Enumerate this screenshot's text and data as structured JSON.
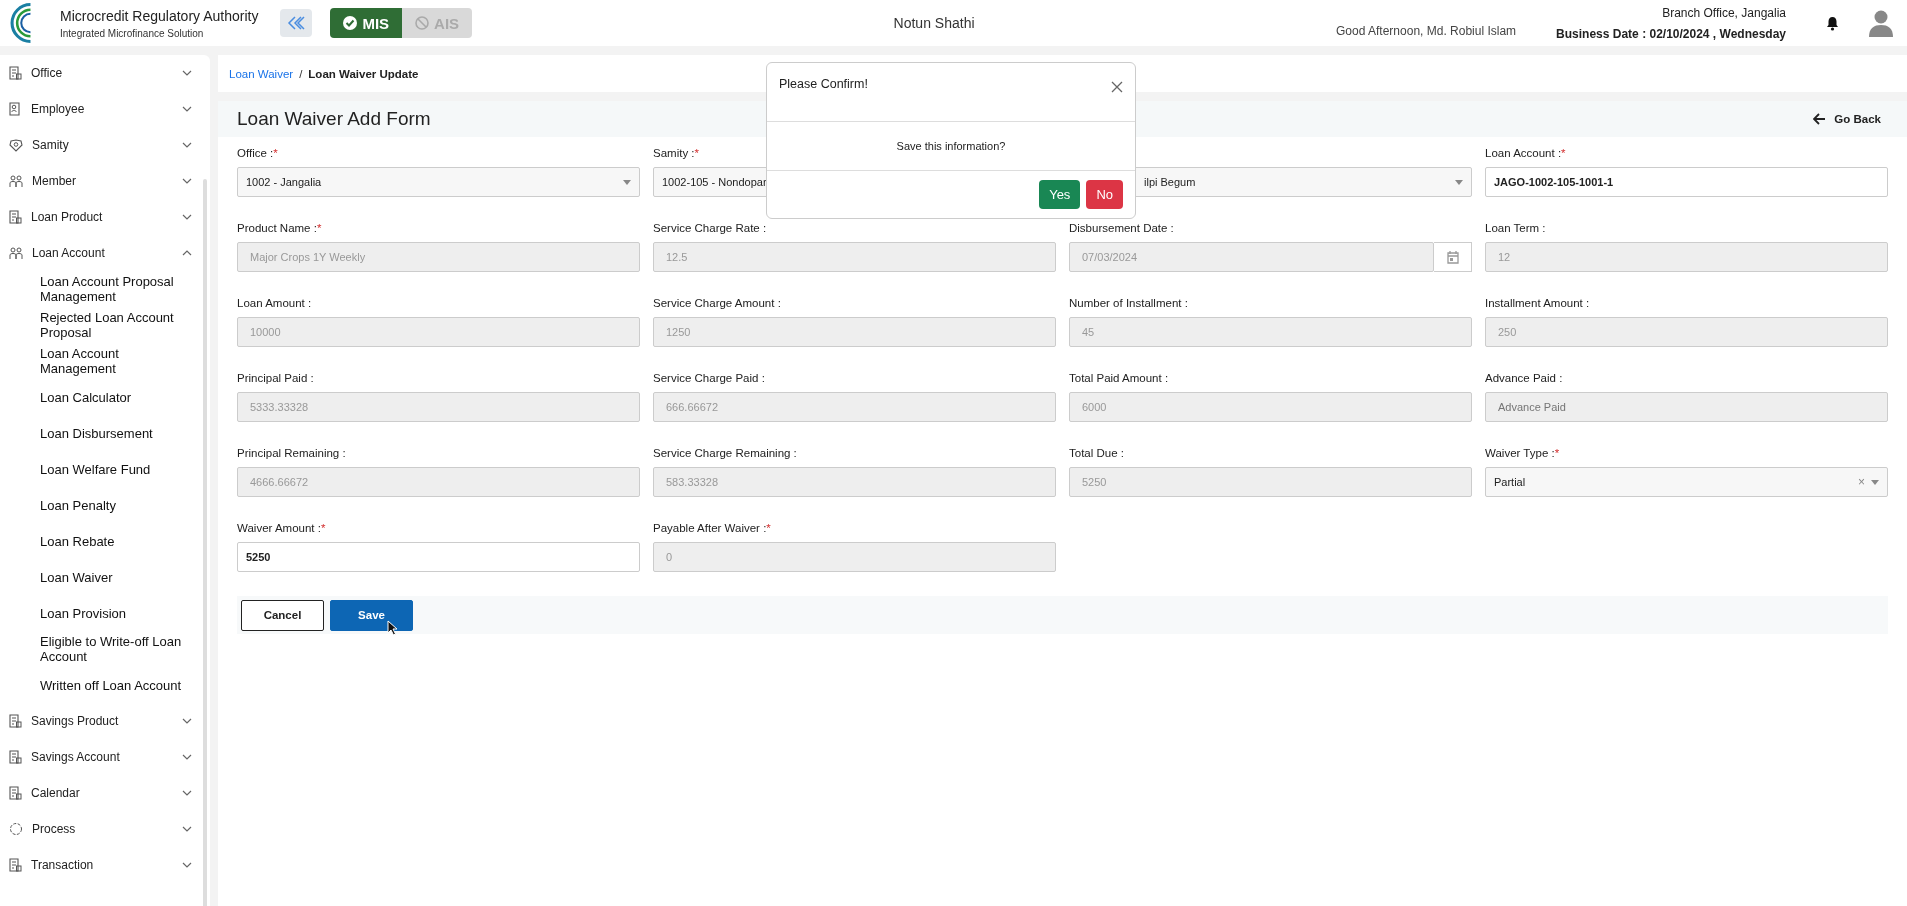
{
  "header": {
    "org_name": "Microcredit Regulatory Authority",
    "org_subtitle": "Integrated Microfinance Solution",
    "modes": [
      {
        "label": "MIS",
        "selected": true
      },
      {
        "label": "AIS",
        "selected": false
      }
    ],
    "app_name": "Notun Shathi",
    "greeting": "Good Afternoon, Md. Robiul Islam",
    "branch": "Branch Office, Jangalia",
    "business_date": "Business Date : 02/10/2024 , Wednesday"
  },
  "sidebar": {
    "items": [
      {
        "label": "Office",
        "kind": "doc",
        "expanded": false
      },
      {
        "label": "Employee",
        "kind": "id",
        "expanded": false
      },
      {
        "label": "Samity",
        "kind": "badge",
        "expanded": false
      },
      {
        "label": "Member",
        "kind": "people",
        "expanded": false
      },
      {
        "label": "Loan Product",
        "kind": "doc",
        "expanded": false
      },
      {
        "label": "Loan Account",
        "kind": "people",
        "expanded": true,
        "children": [
          {
            "label": "Loan Account Proposal Management"
          },
          {
            "label": "Rejected Loan Account Proposal"
          },
          {
            "label": "Loan Account Management"
          },
          {
            "label": "Loan Calculator"
          },
          {
            "label": "Loan Disbursement"
          },
          {
            "label": "Loan Welfare Fund"
          },
          {
            "label": "Loan Penalty"
          },
          {
            "label": "Loan Rebate"
          },
          {
            "label": "Loan Waiver"
          },
          {
            "label": "Loan Provision"
          },
          {
            "label": "Eligible to Write-off Loan Account"
          },
          {
            "label": "Written off Loan Account"
          }
        ]
      },
      {
        "label": "Savings Product",
        "kind": "doc",
        "expanded": false
      },
      {
        "label": "Savings Account",
        "kind": "doc",
        "expanded": false
      },
      {
        "label": "Calendar",
        "kind": "doc",
        "expanded": false
      },
      {
        "label": "Process",
        "kind": "process",
        "expanded": false
      },
      {
        "label": "Transaction",
        "kind": "doc",
        "expanded": false
      }
    ]
  },
  "breadcrumb": [
    {
      "label": "Loan Waiver",
      "kind": "link"
    },
    {
      "label": "/",
      "kind": "separator"
    },
    {
      "label": "Loan Waiver Update",
      "kind": "current"
    }
  ],
  "form": {
    "title": "Loan Waiver Add Form",
    "back": "Go Back",
    "fields": [
      {
        "label": "Office :",
        "required_mark": "*",
        "kind": "select",
        "value": "1002 - Jangalia",
        "disabled": false
      },
      {
        "label": "Samity :",
        "required_mark": "*",
        "kind": "select",
        "value": "1002-105 - Nondopar",
        "disabled": false
      },
      {
        "kind": "select",
        "value": "ilpi Begum",
        "disabled": false
      },
      {
        "label": "Loan Account :",
        "required_mark": "*",
        "kind": "text",
        "value": "JAGO-1002-105-1001-1",
        "disabled": false
      },
      {
        "label": "Product Name :",
        "required_mark": "*",
        "kind": "text",
        "value": "Major Crops 1Y Weekly",
        "disabled": true
      },
      {
        "label": "Service Charge Rate :",
        "kind": "text",
        "value": "12.5",
        "disabled": true
      },
      {
        "label": "Disbursement Date :",
        "kind": "date",
        "value": "07/03/2024",
        "disabled": true
      },
      {
        "label": "Loan Term :",
        "kind": "text",
        "value": "12",
        "disabled": true
      },
      {
        "label": "Loan Amount :",
        "kind": "text",
        "value": "10000",
        "disabled": true
      },
      {
        "label": "Service Charge Amount :",
        "kind": "text",
        "value": "1250",
        "disabled": true
      },
      {
        "label": "Number of Installment :",
        "kind": "text",
        "value": "45",
        "disabled": true
      },
      {
        "label": "Installment Amount :",
        "kind": "text",
        "value": "250",
        "disabled": true
      },
      {
        "label": "Principal Paid :",
        "kind": "text",
        "value": "5333.33328",
        "disabled": true
      },
      {
        "label": "Service Charge Paid :",
        "kind": "text",
        "value": "666.66672",
        "disabled": true
      },
      {
        "label": "Total Paid Amount :",
        "kind": "text",
        "value": "6000",
        "disabled": true
      },
      {
        "label": "Advance Paid :",
        "kind": "text",
        "placeholder": "Advance Paid",
        "disabled": true
      },
      {
        "label": "Principal Remaining :",
        "kind": "text",
        "value": "4666.66672",
        "disabled": true
      },
      {
        "label": "Service Charge Remaining :",
        "kind": "text",
        "value": "583.33328",
        "disabled": true
      },
      {
        "label": "Total Due :",
        "kind": "text",
        "value": "5250",
        "disabled": true
      },
      {
        "label": "Waiver Type :",
        "required_mark": "*",
        "kind": "select",
        "value": "Partial",
        "disabled": false,
        "clear": "×"
      },
      {
        "label": "Waiver Amount :",
        "required_mark": "*",
        "kind": "text",
        "value": "5250",
        "disabled": false
      },
      {
        "label": "Payable After Waiver :",
        "required_mark": "*",
        "kind": "text",
        "value": "0",
        "disabled": true
      }
    ],
    "buttons": [
      {
        "label": "Cancel",
        "kind": "outline"
      },
      {
        "label": "Save",
        "kind": "primary"
      }
    ]
  },
  "dialog": {
    "title": "Please Confirm!",
    "message": "Save this information?",
    "buttons": [
      {
        "label": "Yes",
        "kind": "confirm"
      },
      {
        "label": "No",
        "kind": "cancel"
      }
    ]
  }
}
